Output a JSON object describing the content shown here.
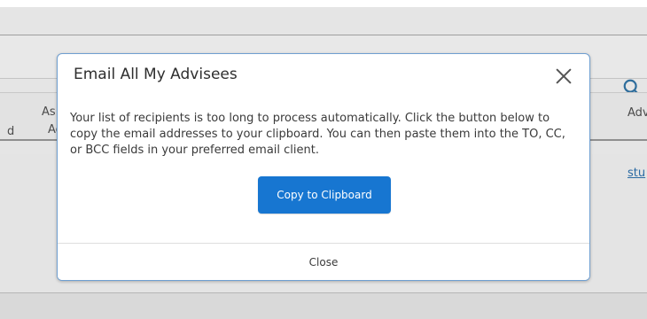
{
  "background": {
    "columns": {
      "partial_d": "d",
      "partial_as": "As",
      "partial_ac": "Ac",
      "partial_adv": "Adv"
    },
    "row_link_partial": "stu"
  },
  "modal": {
    "title": "Email All My Advisees",
    "message": "Your list of recipients is too long to process automatically. Click the button below to copy the email addresses to your clipboard. You can then paste them into the TO, CC, or BCC fields in your preferred email client.",
    "copy_button_label": "Copy to Clipboard",
    "close_button_label": "Close"
  },
  "icons": {
    "search": "search-icon",
    "close": "close-icon"
  },
  "colors": {
    "primary_button": "#1776d1",
    "modal_border": "#6f9fd1",
    "link": "#2a6aa3",
    "backdrop": "#e5e5e5"
  }
}
